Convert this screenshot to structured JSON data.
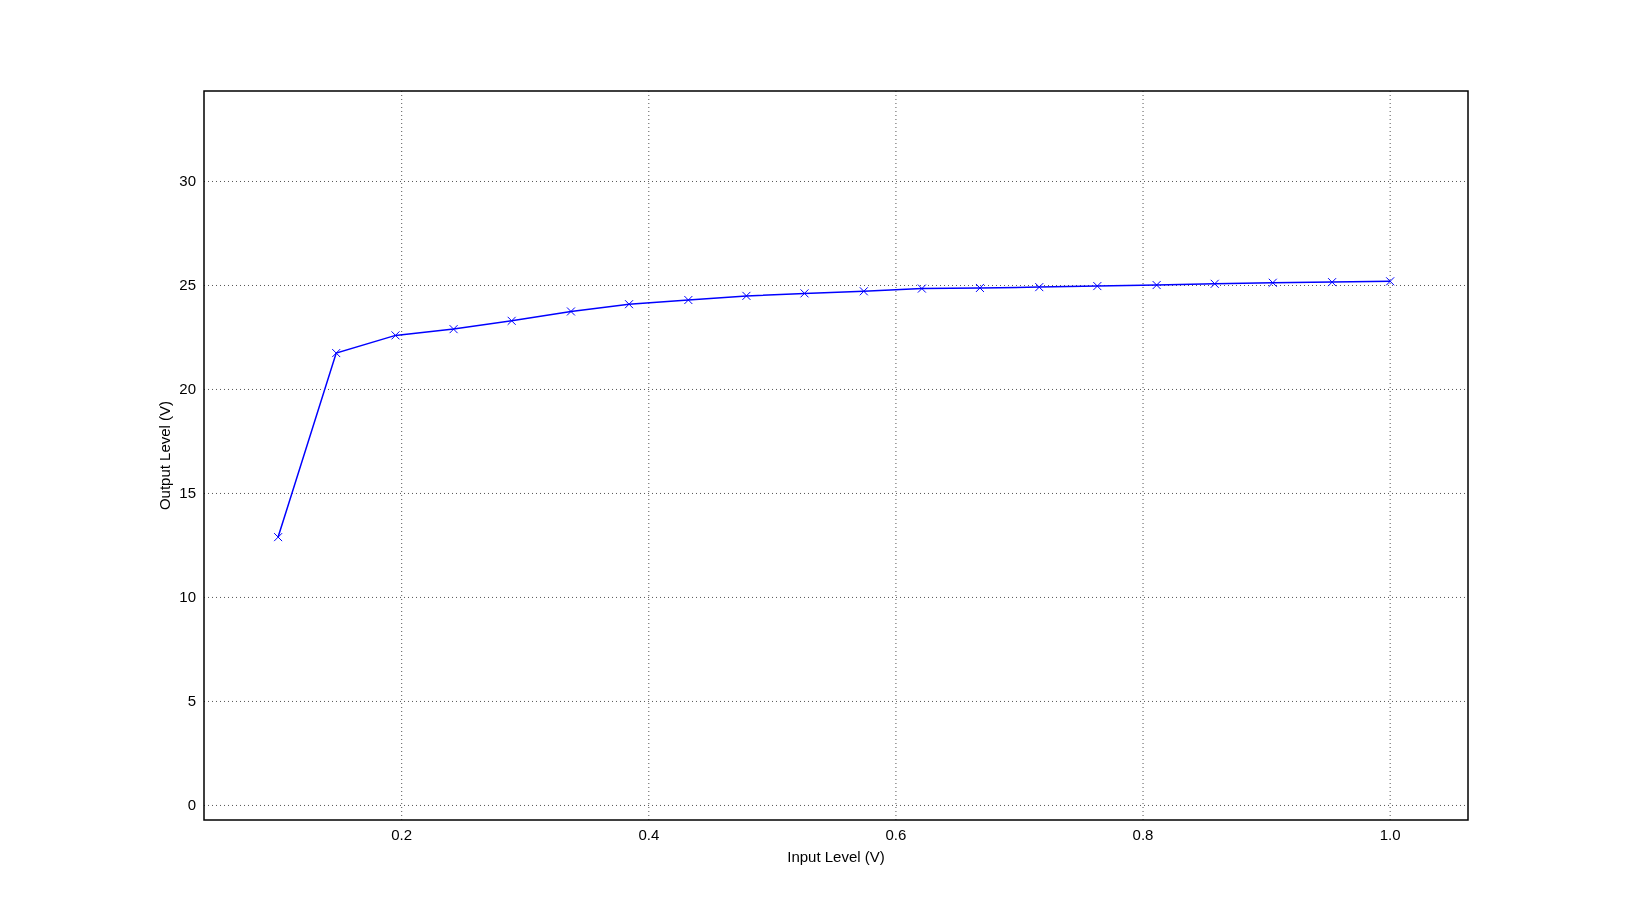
{
  "chart_data": {
    "type": "line",
    "xlabel": "Input Level (V)",
    "ylabel": "Output Level (V)",
    "x": [
      0.1,
      0.147,
      0.195,
      0.242,
      0.289,
      0.337,
      0.384,
      0.432,
      0.479,
      0.526,
      0.574,
      0.621,
      0.668,
      0.716,
      0.763,
      0.811,
      0.858,
      0.905,
      0.953,
      1.0
    ],
    "grid": true,
    "series": [
      {
        "color": "#0000ff",
        "marker": "x",
        "values": [
          12.9,
          21.75,
          22.6,
          22.9,
          23.3,
          23.75,
          24.1,
          24.3,
          24.5,
          24.62,
          24.72,
          24.85,
          24.88,
          24.92,
          24.97,
          25.02,
          25.08,
          25.13,
          25.16,
          25.2
        ]
      }
    ],
    "xlim": [
      0.04,
      1.063
    ],
    "ylim": [
      -0.7,
      34.35
    ],
    "xticks": [
      0.2,
      0.4,
      0.6,
      0.8,
      {
        "value": 1.0,
        "label": "1.0"
      }
    ],
    "yticks": [
      0,
      5,
      10,
      15,
      20,
      25,
      30
    ]
  }
}
